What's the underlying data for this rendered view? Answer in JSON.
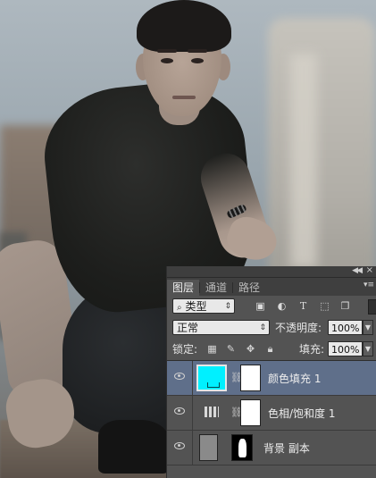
{
  "panel": {
    "tabs": [
      {
        "label": "图层",
        "active": true
      },
      {
        "label": "通道",
        "active": false
      },
      {
        "label": "路径",
        "active": false
      }
    ],
    "filter": {
      "kind_label": "类型"
    },
    "blend_mode": "正常",
    "opacity_label": "不透明度:",
    "opacity_value": "100%",
    "lock_label": "锁定:",
    "fill_label": "填充:",
    "fill_value": "100%",
    "layers": [
      {
        "name": "颜色填充 1",
        "thumbnail_color": "#00f0ff",
        "selected": true
      },
      {
        "name": "色相/饱和度 1",
        "selected": false
      },
      {
        "name": "背景 副本",
        "selected": false
      }
    ]
  },
  "colors": {
    "panel_bg": "#535353",
    "selected_layer": "#5f6f8a",
    "fill_swatch": "#00f0ff"
  },
  "icons": [
    "collapse-icon",
    "close-icon",
    "panel-menu-icon",
    "image-filter-icon",
    "adjustment-filter-icon",
    "type-filter-icon",
    "shape-filter-icon",
    "smart-object-filter-icon",
    "eye-icon",
    "link-icon",
    "lock-transparent-icon",
    "lock-brush-icon",
    "lock-move-icon",
    "lock-all-icon"
  ]
}
